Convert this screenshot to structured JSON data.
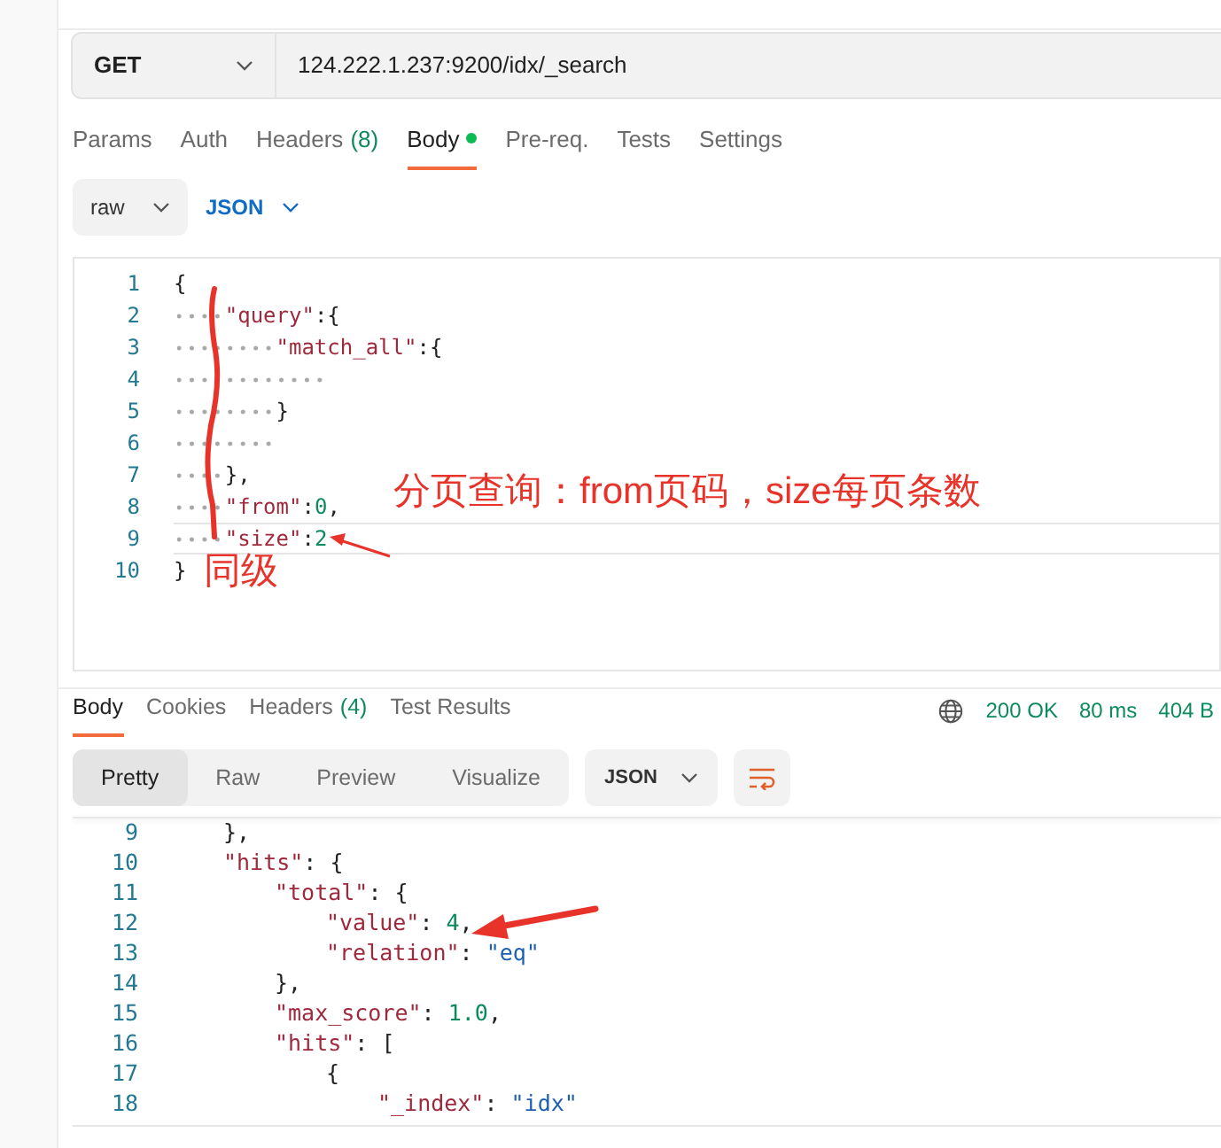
{
  "request": {
    "method": "GET",
    "url": "124.222.1.237:9200/idx/_search",
    "tabs": [
      {
        "label": "Params",
        "selected": false,
        "modified": false
      },
      {
        "label": "Auth",
        "selected": false,
        "modified": false
      },
      {
        "label": "Headers",
        "count": "(8)",
        "selected": false,
        "modified": false
      },
      {
        "label": "Body",
        "selected": true,
        "modified": true
      },
      {
        "label": "Pre-req.",
        "selected": false,
        "modified": false
      },
      {
        "label": "Tests",
        "selected": false,
        "modified": false
      },
      {
        "label": "Settings",
        "selected": false,
        "modified": false
      }
    ],
    "body_mode": "raw",
    "language": "JSON",
    "editor_lines": [
      {
        "number": "1",
        "current": false,
        "tokens": [
          {
            "kind": "punct",
            "text": "{"
          }
        ],
        "children": [
          {
            "number": "2",
            "current": false,
            "tokens": [
              {
                "kind": "key",
                "text": "\"query\""
              },
              {
                "kind": "punct",
                "text": ":{"
              }
            ],
            "children": [
              {
                "number": "3",
                "current": false,
                "tokens": [
                  {
                    "kind": "key",
                    "text": "\"match_all\""
                  },
                  {
                    "kind": "punct",
                    "text": ":{"
                  }
                ],
                "children": [
                  {
                    "number": "4",
                    "current": false
                  }
                ]
              },
              {
                "number": "5",
                "current": false,
                "tokens": [
                  {
                    "kind": "punct",
                    "text": "}"
                  }
                ]
              },
              {
                "number": "6",
                "current": false
              }
            ]
          },
          {
            "number": "7",
            "current": false,
            "tokens": [
              {
                "kind": "punct",
                "text": "},"
              }
            ]
          },
          {
            "number": "8",
            "current": false,
            "tokens": [
              {
                "kind": "key",
                "text": "\"from\""
              },
              {
                "kind": "punct",
                "text": ":"
              },
              {
                "kind": "number",
                "text": "0"
              },
              {
                "kind": "punct",
                "text": ","
              }
            ]
          },
          {
            "number": "9",
            "current": true,
            "tokens": [
              {
                "kind": "key",
                "text": "\"size\""
              },
              {
                "kind": "punct",
                "text": ":"
              },
              {
                "kind": "number",
                "text": "2"
              }
            ]
          }
        ]
      },
      {
        "number": "10",
        "current": false,
        "tokens": [
          {
            "kind": "punct",
            "text": "}"
          }
        ]
      }
    ]
  },
  "response": {
    "tabs": [
      {
        "label": "Body",
        "selected": true
      },
      {
        "label": "Cookies",
        "selected": false
      },
      {
        "label": "Headers",
        "count": "(4)",
        "selected": false
      },
      {
        "label": "Test Results",
        "selected": false
      }
    ],
    "status": "200 OK",
    "time": "80 ms",
    "size": "404 B",
    "views": [
      {
        "label": "Pretty",
        "selected": true
      },
      {
        "label": "Raw",
        "selected": false
      },
      {
        "label": "Preview",
        "selected": false
      },
      {
        "label": "Visualize",
        "selected": false
      }
    ],
    "language": "JSON",
    "lines": [
      {
        "number": "9",
        "tokens": [
          {
            "kind": "punct",
            "text": "},"
          }
        ]
      },
      {
        "number": "10",
        "tokens": [
          {
            "kind": "key",
            "text": "\"hits\""
          },
          {
            "kind": "punct",
            "text": ": {"
          }
        ],
        "children": [
          {
            "number": "11",
            "tokens": [
              {
                "kind": "key",
                "text": "\"total\""
              },
              {
                "kind": "punct",
                "text": ": {"
              }
            ],
            "children": [
              {
                "number": "12",
                "tokens": [
                  {
                    "kind": "key",
                    "text": "\"value\""
                  },
                  {
                    "kind": "punct",
                    "text": ": "
                  },
                  {
                    "kind": "number",
                    "text": "4"
                  },
                  {
                    "kind": "punct",
                    "text": ","
                  }
                ]
              },
              {
                "number": "13",
                "tokens": [
                  {
                    "kind": "key",
                    "text": "\"relation\""
                  },
                  {
                    "kind": "punct",
                    "text": ": "
                  },
                  {
                    "kind": "string",
                    "text": "\"eq\""
                  }
                ]
              }
            ]
          },
          {
            "number": "14",
            "tokens": [
              {
                "kind": "punct",
                "text": "},"
              }
            ]
          },
          {
            "number": "15",
            "tokens": [
              {
                "kind": "key",
                "text": "\"max_score\""
              },
              {
                "kind": "punct",
                "text": ": "
              },
              {
                "kind": "number",
                "text": "1.0"
              },
              {
                "kind": "punct",
                "text": ","
              }
            ]
          },
          {
            "number": "16",
            "tokens": [
              {
                "kind": "key",
                "text": "\"hits\""
              },
              {
                "kind": "punct",
                "text": ": ["
              }
            ],
            "children": [
              {
                "number": "17",
                "tokens": [
                  {
                    "kind": "punct",
                    "text": "{"
                  }
                ],
                "children": [
                  {
                    "number": "18",
                    "tokens": [
                      {
                        "kind": "key",
                        "text": "\"_index\""
                      },
                      {
                        "kind": "punct",
                        "text": ": "
                      },
                      {
                        "kind": "string",
                        "text": "\"idx\""
                      }
                    ]
                  }
                ]
              }
            ]
          }
        ]
      }
    ]
  },
  "annotations": [
    {
      "kind": "note",
      "text": "分页查询：from页码，size每页条数"
    },
    {
      "kind": "bracket_label",
      "text": "同级"
    }
  ]
}
